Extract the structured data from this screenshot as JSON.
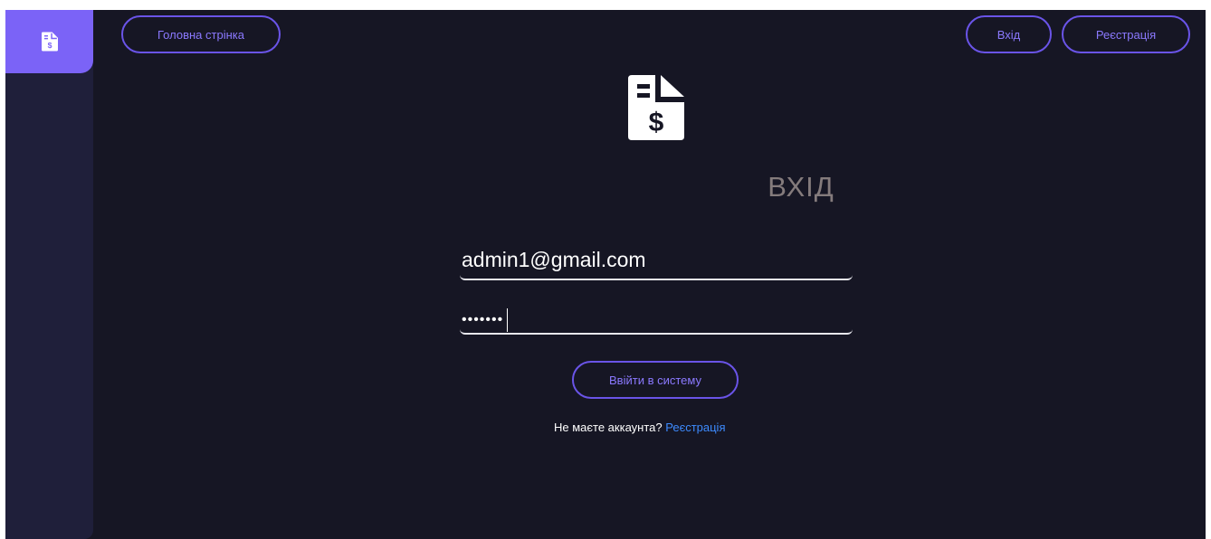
{
  "sidebar": {
    "logo_icon": "receipt-dollar-icon",
    "accent": "#7b63f7"
  },
  "nav": {
    "home_label": "Головна стрінка",
    "login_label": "Вхід",
    "register_label": "Реєстрація"
  },
  "login": {
    "icon": "receipt-dollar-icon",
    "title": "ВХІД",
    "email_value": "admin1@gmail.com",
    "password_value": "•••••••",
    "submit_label": "Ввійти в систему",
    "no_account_text": "Не маєте аккаунта?",
    "register_link": "Реєстрація"
  },
  "colors": {
    "background": "#161624",
    "sidebar": "#1f1f3a",
    "button_border": "#6a54e8",
    "button_text": "#8b79ff",
    "link": "#3d8bff",
    "title": "#847b7c"
  }
}
